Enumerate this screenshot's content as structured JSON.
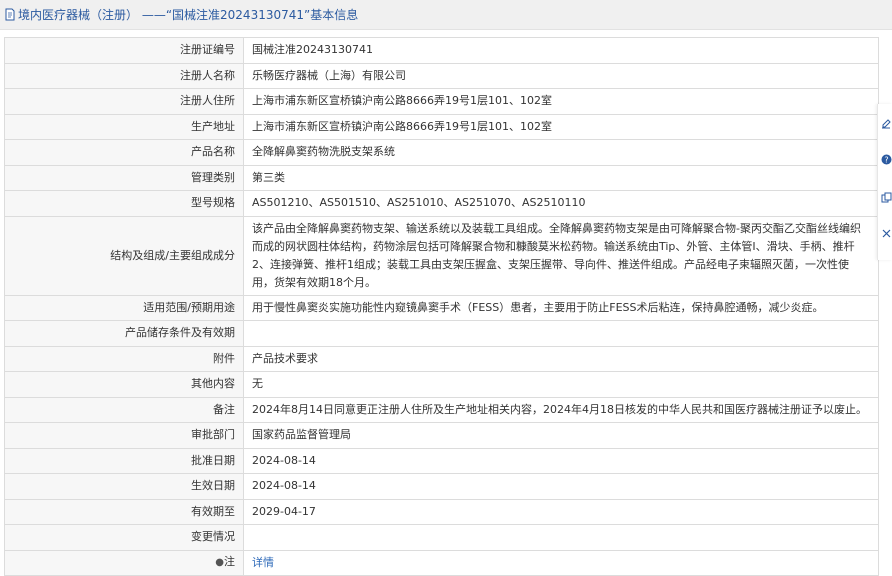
{
  "header": {
    "title": "境内医疗器械（注册） ——“国械注准20243130741”基本信息",
    "icon": "document-icon"
  },
  "rows": [
    {
      "label": "注册证编号",
      "value": "国械注准20243130741"
    },
    {
      "label": "注册人名称",
      "value": "乐畅医疗器械（上海）有限公司"
    },
    {
      "label": "注册人住所",
      "value": "上海市浦东新区宣桥镇沪南公路8666弄19号1层101、102室"
    },
    {
      "label": "生产地址",
      "value": "上海市浦东新区宣桥镇沪南公路8666弄19号1层101、102室"
    },
    {
      "label": "产品名称",
      "value": "全降解鼻窦药物洗脱支架系统"
    },
    {
      "label": "管理类别",
      "value": "第三类"
    },
    {
      "label": "型号规格",
      "value": "AS501210、AS501510、AS251010、AS251070、AS2510110"
    },
    {
      "label": "结构及组成/主要组成成分",
      "value": "该产品由全降解鼻窦药物支架、输送系统以及装载工具组成。全降解鼻窦药物支架是由可降解聚合物-聚丙交酯乙交酯丝线编织而成的网状圆柱体结构，药物涂层包括可降解聚合物和糠酸莫米松药物。输送系统由Tip、外管、主体管I、滑块、手柄、推杆2、连接弹簧、推杆1组成；装载工具由支架压握盒、支架压握带、导向件、推送件组成。产品经电子束辐照灭菌，一次性使用，货架有效期18个月。"
    },
    {
      "label": "适用范围/预期用途",
      "value": "用于慢性鼻窦炎实施功能性内窥镜鼻窦手术（FESS）患者，主要用于防止FESS术后粘连，保持鼻腔通畅，减少炎症。"
    },
    {
      "label": "产品储存条件及有效期",
      "value": ""
    },
    {
      "label": "附件",
      "value": "产品技术要求"
    },
    {
      "label": "其他内容",
      "value": "无"
    },
    {
      "label": "备注",
      "value": "2024年8月14日同意更正注册人住所及生产地址相关内容，2024年4月18日核发的中华人民共和国医疗器械注册证予以废止。"
    },
    {
      "label": "审批部门",
      "value": "国家药品监督管理局"
    },
    {
      "label": "批准日期",
      "value": "2024-08-14"
    },
    {
      "label": "生效日期",
      "value": "2024-08-14"
    },
    {
      "label": "有效期至",
      "value": "2029-04-17"
    },
    {
      "label": "变更情况",
      "value": ""
    },
    {
      "label": "注",
      "value": "详情",
      "icon": "lightbulb-icon"
    }
  ],
  "side_tools": [
    "edit-icon",
    "help-icon",
    "copy-icon",
    "close-icon"
  ],
  "colors": {
    "link": "#2c68b8",
    "title": "#2b5aa0",
    "label_bg": "#f7f7f7",
    "border": "#dcdcdc"
  }
}
